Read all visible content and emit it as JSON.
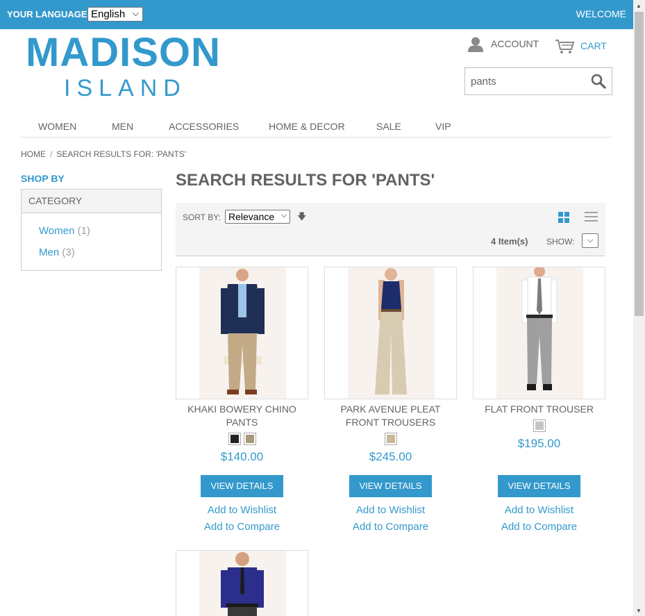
{
  "topbar": {
    "language_label": "YOUR LANGUAGE:",
    "language_value": "English",
    "welcome": "WELCOME"
  },
  "logo": {
    "line1": "MADISON",
    "line2": "ISLAND"
  },
  "header": {
    "account_label": "ACCOUNT",
    "cart_label": "CART"
  },
  "search": {
    "value": "pants"
  },
  "nav": {
    "items": [
      "WOMEN",
      "MEN",
      "ACCESSORIES",
      "HOME & DECOR",
      "SALE",
      "VIP"
    ]
  },
  "breadcrumb": {
    "home": "HOME",
    "separator": "/",
    "current": "SEARCH RESULTS FOR: 'PANTS'"
  },
  "sidebar": {
    "shop_by": "SHOP BY",
    "category_title": "CATEGORY",
    "categories": [
      {
        "label": "Women",
        "count": "(1)"
      },
      {
        "label": "Men",
        "count": "(3)"
      }
    ]
  },
  "results": {
    "title": "SEARCH RESULTS FOR 'PANTS'",
    "sort_label": "SORT BY:",
    "sort_value": "Relevance",
    "item_count": "4 Item(s)",
    "show_label": "SHOW:"
  },
  "products": [
    {
      "name": "KHAKI BOWERY CHINO PANTS",
      "price": "$140.00",
      "swatches": [
        "#222222",
        "#a89a7e"
      ],
      "button": "VIEW DETAILS",
      "wishlist": "Add to Wishlist",
      "compare": "Add to Compare"
    },
    {
      "name": "PARK AVENUE PLEAT FRONT TROUSERS",
      "price": "$245.00",
      "swatches": [
        "#c8b99a"
      ],
      "button": "VIEW DETAILS",
      "wishlist": "Add to Wishlist",
      "compare": "Add to Compare"
    },
    {
      "name": "FLAT FRONT TROUSER",
      "price": "$195.00",
      "swatches": [
        "#c4c4c4"
      ],
      "button": "VIEW DETAILS",
      "wishlist": "Add to Wishlist",
      "compare": "Add to Compare"
    }
  ],
  "colors": {
    "accent": "#3399cc",
    "text": "#636363"
  }
}
